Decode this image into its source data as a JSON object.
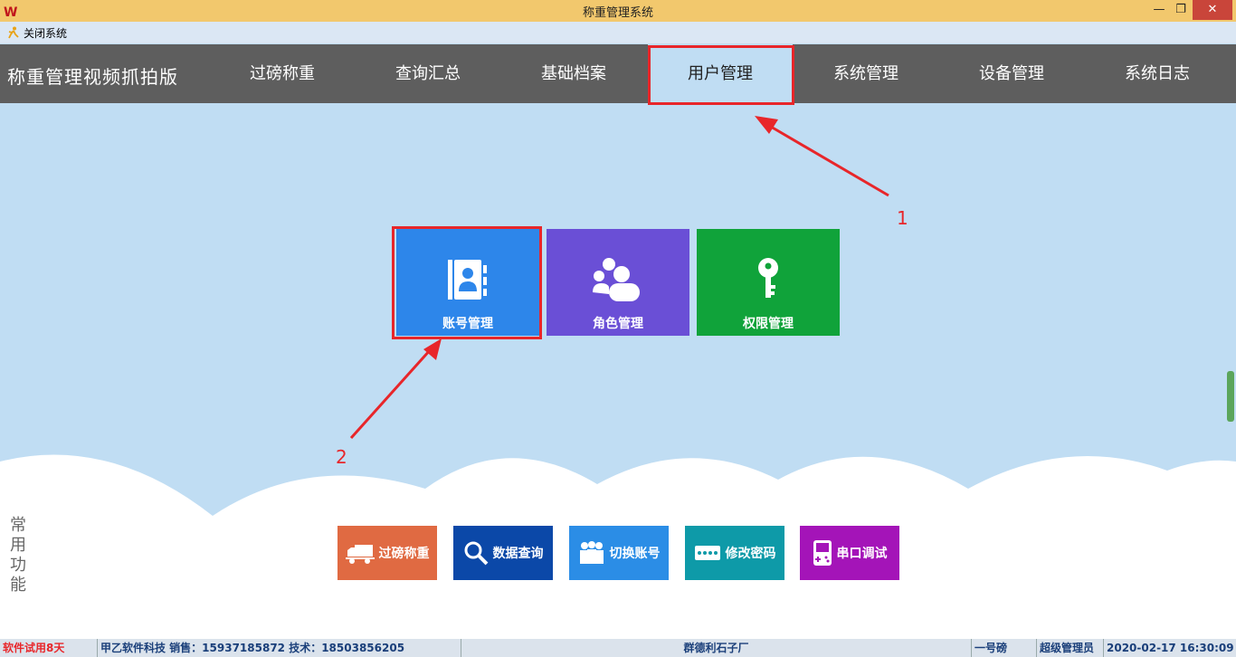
{
  "window": {
    "title": "称重管理系统"
  },
  "menubar": {
    "close_system": "关闭系统"
  },
  "nav": {
    "app_name": "称重管理视频抓拍版",
    "items": [
      {
        "label": "过磅称重"
      },
      {
        "label": "查询汇总"
      },
      {
        "label": "基础档案"
      },
      {
        "label": "用户管理",
        "active": true
      },
      {
        "label": "系统管理"
      },
      {
        "label": "设备管理"
      },
      {
        "label": "系统日志"
      }
    ]
  },
  "tiles": [
    {
      "label": "账号管理",
      "icon": "contact-book-icon",
      "color": "#2d86ea"
    },
    {
      "label": "角色管理",
      "icon": "users-group-icon",
      "color": "#6a4fd6"
    },
    {
      "label": "权限管理",
      "icon": "key-icon",
      "color": "#10a33a"
    }
  ],
  "quick": {
    "label": "常用功能",
    "buttons": [
      {
        "label": "过磅称重",
        "icon": "truck-icon",
        "color": "#e06a42"
      },
      {
        "label": "数据查询",
        "icon": "search-icon",
        "color": "#0b48a8"
      },
      {
        "label": "切换账号",
        "icon": "users-icon",
        "color": "#2b8de6"
      },
      {
        "label": "修改密码",
        "icon": "password-icon",
        "color": "#0e9aa8"
      },
      {
        "label": "串口调试",
        "icon": "device-icon",
        "color": "#a414b8"
      }
    ]
  },
  "annotations": {
    "one": "1",
    "two": "2"
  },
  "statusbar": {
    "trial": "软件试用8天",
    "company": "甲乙软件科技 销售：15937185872 技术：18503856205",
    "factory": "群德利石子厂",
    "scale": "一号磅",
    "role": "超级管理员",
    "datetime": "2020-02-17 16:30:09"
  },
  "colors": {
    "accent_red": "#e8262a",
    "nav_bg": "#5e5e5e",
    "page_bg": "#c0ddf3"
  }
}
